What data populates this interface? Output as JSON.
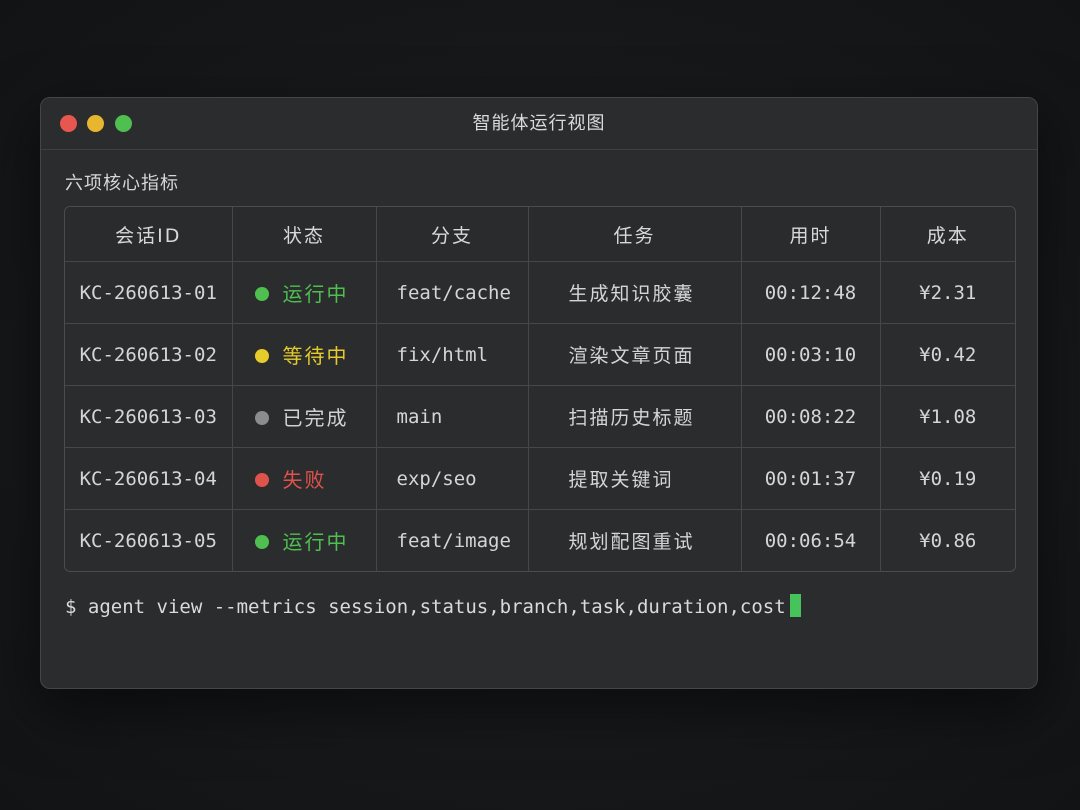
{
  "window": {
    "title": "智能体运行视图"
  },
  "section_title": "六项核心指标",
  "table": {
    "headers": [
      "会话ID",
      "状态",
      "分支",
      "任务",
      "用时",
      "成本"
    ],
    "rows": [
      {
        "session": "KC-260613-01",
        "status": "运行中",
        "status_color": "#4fbf50",
        "branch": "feat/cache",
        "task": "生成知识胶囊",
        "duration": "00:12:48",
        "cost": "¥2.31"
      },
      {
        "session": "KC-260613-02",
        "status": "等待中",
        "status_color": "#e6cc2a",
        "branch": "fix/html",
        "task": "渲染文章页面",
        "duration": "00:03:10",
        "cost": "¥0.42"
      },
      {
        "session": "KC-260613-03",
        "status": "已完成",
        "status_color": "#8a8c8e",
        "branch": "main",
        "task": "扫描历史标题",
        "duration": "00:08:22",
        "cost": "¥1.08"
      },
      {
        "session": "KC-260613-04",
        "status": "失败",
        "status_color": "#e0534c",
        "branch": "exp/seo",
        "task": "提取关键词",
        "duration": "00:01:37",
        "cost": "¥0.19"
      },
      {
        "session": "KC-260613-05",
        "status": "运行中",
        "status_color": "#4fbf50",
        "branch": "feat/image",
        "task": "规划配图重试",
        "duration": "00:06:54",
        "cost": "¥0.86"
      }
    ]
  },
  "terminal": {
    "command": "$ agent view --metrics session,status,branch,task,duration,cost",
    "cursor_color": "#46c35a"
  },
  "colors": {
    "status_done_text": "#cfd1d3"
  }
}
